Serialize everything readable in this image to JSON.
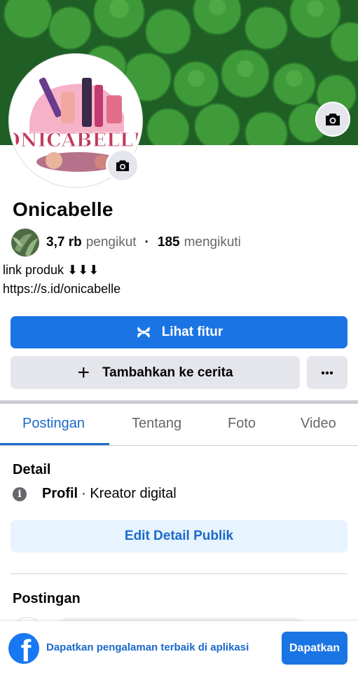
{
  "profile": {
    "name": "Onicabelle",
    "avatar_brand_text": "ONICABELLE",
    "followers_count": "3,7 rb",
    "followers_label": "pengikut",
    "following_count": "185",
    "following_label": "mengikuti",
    "bio_line1": "link produk ⬇⬇⬇",
    "bio_line2": "https://s.id/onicabelle"
  },
  "actions": {
    "primary_label": "Lihat fitur",
    "add_story_label": "Tambahkan ke cerita",
    "more_label": "•••",
    "edit_details_label": "Edit Detail Publik"
  },
  "tabs": [
    {
      "label": "Postingan",
      "active": true
    },
    {
      "label": "Tentang",
      "active": false
    },
    {
      "label": "Foto",
      "active": false
    },
    {
      "label": "Video",
      "active": false
    }
  ],
  "details": {
    "title": "Detail",
    "type_label": "Profil",
    "type_value": "· Kreator digital"
  },
  "posts": {
    "title": "Postingan"
  },
  "app_banner": {
    "logo_letter": "f",
    "text": "Dapatkan pengalaman terbaik di aplikasi",
    "button_label": "Dapatkan"
  },
  "colors": {
    "brand_blue": "#1b74e4",
    "link_blue": "#1b6ac9",
    "secondary_button": "#e4e6eb",
    "edit_button_bg": "#e7f3ff"
  },
  "icons": [
    "camera-icon",
    "feature-icon",
    "plus-icon",
    "more-icon",
    "info-icon",
    "facebook-logo-icon"
  ]
}
